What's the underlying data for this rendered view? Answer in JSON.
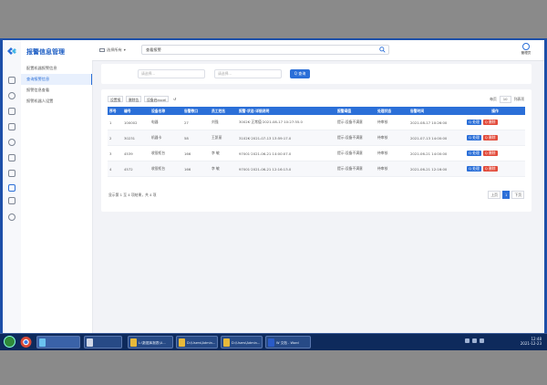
{
  "sidebar": {
    "title": "报警信息管理",
    "items": [
      {
        "label": "配置机器报警信息"
      },
      {
        "label": "查询报警信息"
      },
      {
        "label": "报警信息查看"
      },
      {
        "label": "报警机器人设置"
      }
    ],
    "active_index": 1
  },
  "header": {
    "scope_label": "选择所有",
    "search_value": "查看报警",
    "user_name": "管理员"
  },
  "filter": {
    "input1_placeholder": "请选择...",
    "input2_placeholder": "请选择...",
    "query_label": "Q 查询"
  },
  "toolbar": {
    "add_label": "设置报",
    "delete_label": "删除告",
    "export_label": "设备启excel",
    "refresh_label": "↺",
    "page_size_label": "每页",
    "page_size_value": "10",
    "columns_label": "列表项"
  },
  "table": {
    "headers": [
      "序号",
      "编号",
      "设备名称",
      "告警数口",
      "员工姓名",
      "报警·状态·详细说明",
      "报警阈值",
      "处理状态",
      "告警时间",
      "操作"
    ],
    "rows": [
      [
        "1",
        "100002",
        "电器",
        "27",
        "刘强",
        "3002K·正常值·2021-08-17 10:27:55.0",
        "提示:设备不满意",
        "待审核",
        "2021-08-17 10:26:00",
        ""
      ],
      [
        "2",
        "30231",
        "机器卡",
        "58",
        "王凯丽",
        "3102K·2021-07-13 13:59:17.0",
        "提示:设备不满意",
        "待审核",
        "2021-07-13 14:00:00",
        ""
      ],
      [
        "3",
        "4539",
        "收银柜台",
        "166",
        "李 敏",
        "97001·2021-06-21 14:00:07.0",
        "提示:设备不满意",
        "待审核",
        "2021-06-21 14:00:00",
        ""
      ],
      [
        "4",
        "4572",
        "收银柜台",
        "166",
        "李 敏",
        "97001·2021-06-21 12:16:13.0",
        "提示:设备不满意",
        "待审核",
        "2021-06-21 12:16:00",
        ""
      ]
    ],
    "op_view": "Q 处理",
    "op_delete": "Q 删除"
  },
  "pagination": {
    "info": "显示第 1 至 4 项结果，共 4 项",
    "prev": "上页",
    "current": "1",
    "next": "下页"
  },
  "taskbar": {
    "items": [
      {
        "label": "L:\\数据库报表\\U...",
        "type": "folder"
      },
      {
        "label": "D:\\Users\\Admin...",
        "type": "folder"
      },
      {
        "label": "D:\\Users\\Admin...",
        "type": "folder"
      },
      {
        "label": "W  文档 - Word",
        "type": "word"
      }
    ],
    "time": "12:48",
    "date": "2021-12-23"
  }
}
